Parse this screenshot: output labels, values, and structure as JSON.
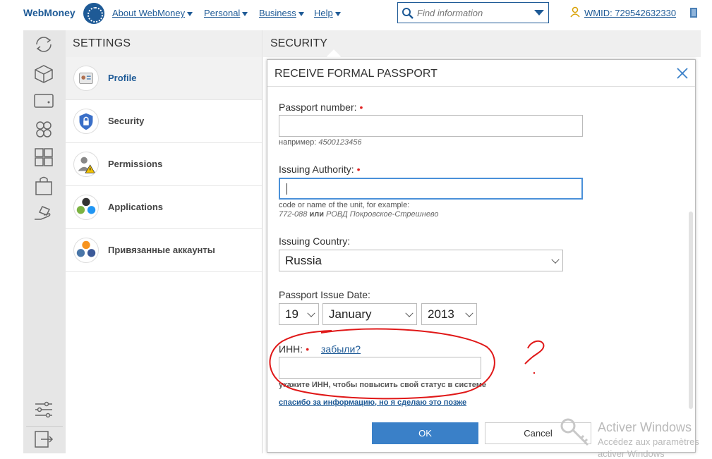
{
  "header": {
    "logo_text": "WebMoney",
    "nav": [
      {
        "label": "About WebMoney"
      },
      {
        "label": "Personal"
      },
      {
        "label": "Business"
      },
      {
        "label": "Help"
      }
    ],
    "search": {
      "placeholder": "Find information"
    },
    "wmid": "WMID: 729542632330"
  },
  "settings": {
    "title": "SETTINGS",
    "items": [
      {
        "label": "Profile",
        "icon": "profile-card-icon",
        "active": true
      },
      {
        "label": "Security",
        "icon": "shield-lock-icon"
      },
      {
        "label": "Permissions",
        "icon": "user-warning-icon"
      },
      {
        "label": "Applications",
        "icon": "apps-icon"
      },
      {
        "label": "Привязанные аккаунты",
        "icon": "social-accounts-icon"
      }
    ]
  },
  "panel": {
    "title": "SECURITY"
  },
  "modal": {
    "title": "RECEIVE FORMAL PASSPORT",
    "passport_number": {
      "label": "Passport number:",
      "value": "",
      "hint_prefix": "например:",
      "hint_example": "4500123456"
    },
    "issuing_authority": {
      "label": "Issuing Authority:",
      "value": "",
      "hint_line1": "code or name of the unit, for example:",
      "hint_ex1": "772-088",
      "hint_or": "или",
      "hint_ex2": "РОВД Покровское-Стрешнево"
    },
    "issuing_country": {
      "label": "Issuing Country:",
      "value": "Russia"
    },
    "issue_date": {
      "label": "Passport Issue Date:",
      "day": "19",
      "month": "January",
      "year": "2013"
    },
    "inn": {
      "label": "ИНН:",
      "forgot_link": "забыли?",
      "value": "",
      "hint": "укажите ИНН, чтобы повысить свой статус в системе"
    },
    "later_link": "спасибо за информацию, но я сделаю это позже",
    "ok_label": "OK",
    "cancel_label": "Cancel"
  },
  "annotation": {
    "mark": "?",
    "color": "#e01818"
  },
  "watermark": {
    "title": "Activer Windows",
    "subtitle": "Accédez aux paramètres",
    "subtitle2": "activer Windows"
  },
  "colors": {
    "brand": "#1e5a96",
    "accent": "#3a80c8",
    "required": "#e02020"
  }
}
